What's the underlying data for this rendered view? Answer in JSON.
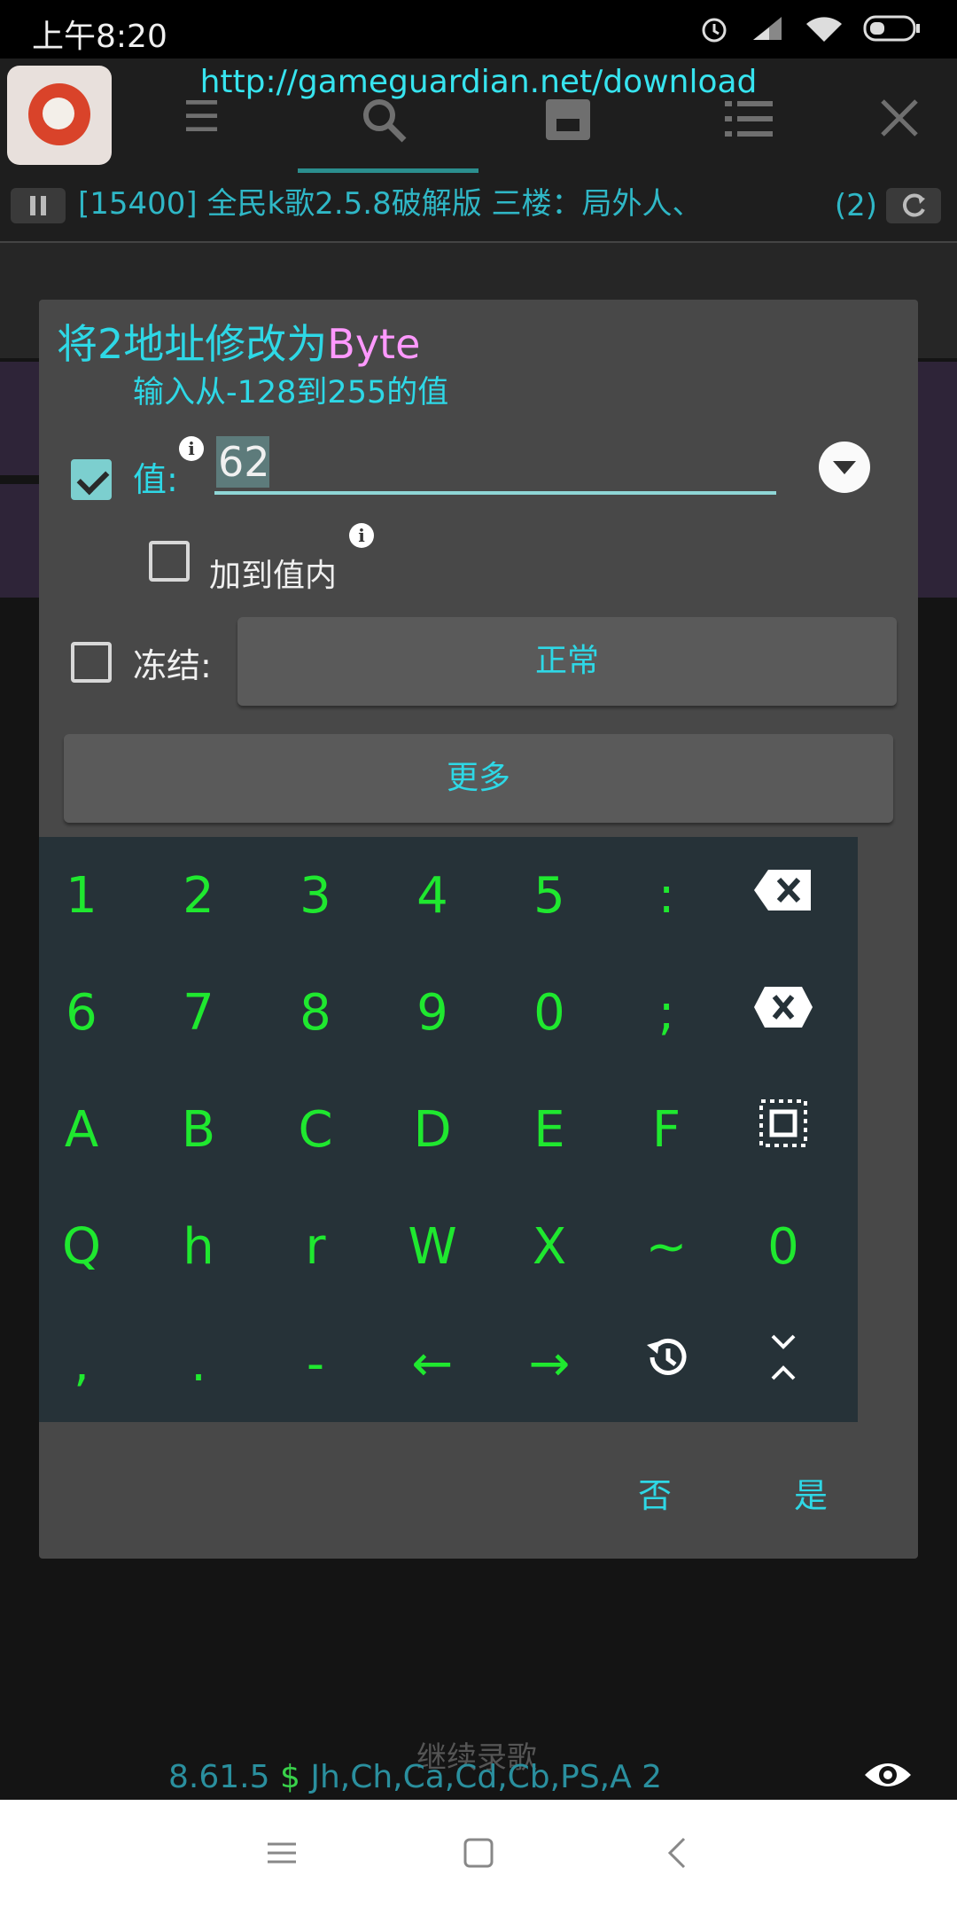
{
  "status_bar": {
    "time": "上午8:20"
  },
  "gg": {
    "url": "http://gameguardian.net/download",
    "process": "[15400] 全民k歌2.5.8破解版  三楼：局外人、",
    "process_count": "(2)",
    "version": "8.61.5",
    "dollar": "$",
    "flags": "Jh,Ch,Ca,Cd,Cb,PS,A 2",
    "background_button": "继续录歌"
  },
  "dialog": {
    "title_prefix": "将2地址修改为",
    "title_type": "Byte",
    "hint": "输入从-128到255的值",
    "value_label": "值:",
    "value": "62",
    "value_checked": true,
    "add_to_value_label": "加到值内",
    "add_to_value_checked": false,
    "freeze_label": "冻结:",
    "freeze_checked": false,
    "freeze_mode": "正常",
    "more_label": "更多",
    "no_label": "否",
    "yes_label": "是"
  },
  "keyboard": {
    "rows": [
      [
        "1",
        "2",
        "3",
        "4",
        "5",
        ":",
        "backspace-icon"
      ],
      [
        "6",
        "7",
        "8",
        "9",
        "0",
        ";",
        "clear-icon"
      ],
      [
        "A",
        "B",
        "C",
        "D",
        "E",
        "F",
        "select-all-icon"
      ],
      [
        "Q",
        "h",
        "r",
        "W",
        "X",
        "~",
        "0"
      ],
      [
        ",",
        ".",
        "-",
        "←",
        "→",
        "history-icon",
        "collapse-icon"
      ]
    ]
  },
  "colors": {
    "accent_cyan": "#2ed8e6",
    "key_green": "#1fe82f",
    "type_pink": "#ff99ff",
    "dialog_bg": "#484848",
    "keyboard_bg": "#263238"
  }
}
